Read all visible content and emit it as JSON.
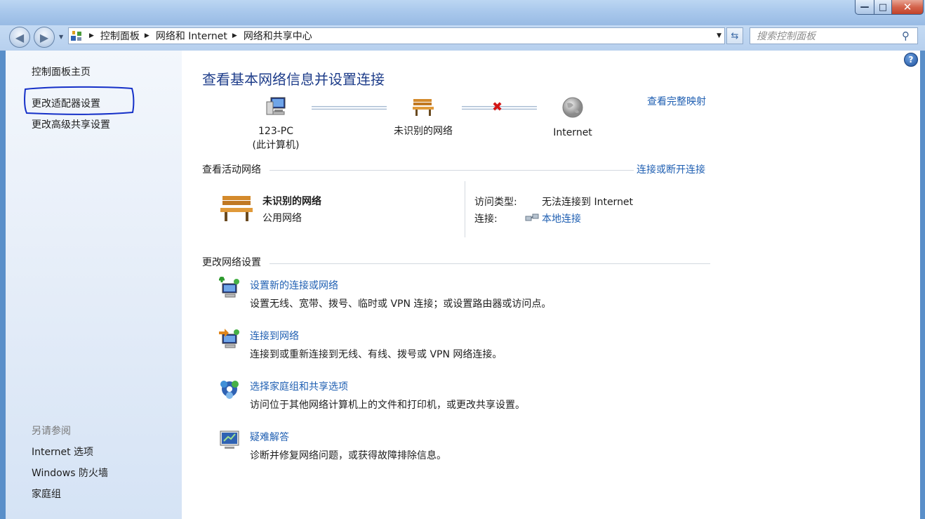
{
  "window": {
    "caption_buttons": {
      "minimize": "—",
      "maximize": "□",
      "close": "✕"
    }
  },
  "nav": {
    "back_icon": "back-arrow-icon",
    "forward_icon": "forward-arrow-icon",
    "breadcrumb": [
      "控制面板",
      "网络和 Internet",
      "网络和共享中心"
    ],
    "search_placeholder": "搜索控制面板"
  },
  "sidebar": {
    "links": [
      "控制面板主页",
      "更改适配器设置",
      "更改高级共享设置"
    ],
    "see_also_heading": "另请参阅",
    "see_also": [
      "Internet 选项",
      "Windows 防火墙",
      "家庭组"
    ]
  },
  "main": {
    "title": "查看基本网络信息并设置连接",
    "map_link": "查看完整映射",
    "map_nodes": [
      {
        "line1": "123-PC",
        "line2": "(此计算机)"
      },
      {
        "line1": "未识别的网络",
        "line2": ""
      },
      {
        "line1": "Internet",
        "line2": ""
      }
    ],
    "active_section": {
      "heading": "查看活动网络",
      "link": "连接或断开连接",
      "network_name": "未识别的网络",
      "network_type": "公用网络",
      "access_type_label": "访问类型:",
      "access_type_value": "无法连接到 Internet",
      "connection_label": "连接:",
      "connection_value": "本地连接"
    },
    "change_section": {
      "heading": "更改网络设置",
      "tasks": [
        {
          "title": "设置新的连接或网络",
          "desc": "设置无线、宽带、拨号、临时或 VPN 连接；或设置路由器或访问点。",
          "icon": "new-connection-icon"
        },
        {
          "title": "连接到网络",
          "desc": "连接到或重新连接到无线、有线、拨号或 VPN 网络连接。",
          "icon": "connect-network-icon"
        },
        {
          "title": "选择家庭组和共享选项",
          "desc": "访问位于其他网络计算机上的文件和打印机，或更改共享设置。",
          "icon": "homegroup-icon"
        },
        {
          "title": "疑难解答",
          "desc": "诊断并修复网络问题，或获得故障排除信息。",
          "icon": "troubleshoot-icon"
        }
      ]
    }
  },
  "colors": {
    "link": "#1f5fb2",
    "title": "#1e3d8a",
    "frame": "#5a8fc9",
    "annotation": "#1530c8"
  }
}
